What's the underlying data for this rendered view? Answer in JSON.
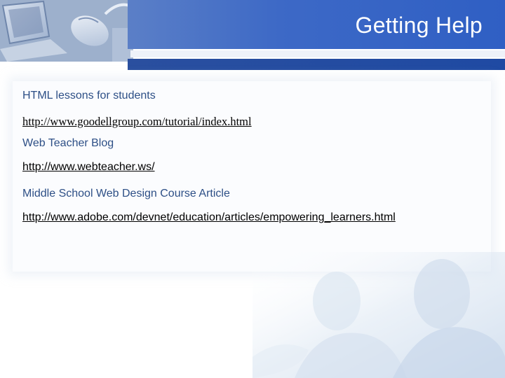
{
  "slide": {
    "title": "Getting Help",
    "items": [
      {
        "heading": "HTML lessons for students",
        "link": "http://www.goodellgroup.com/tutorial/index.html"
      },
      {
        "heading": "Web Teacher Blog",
        "link": "http://www.webteacher.ws/"
      },
      {
        "heading": "Middle School Web Design Course Article",
        "link": "http://www.adobe.com/devnet/education/articles/empowering_learners.html"
      }
    ]
  },
  "colors": {
    "banner": "#3d69c6",
    "heading_text": "#2d4f86",
    "link_text": "#000000"
  },
  "icons": {
    "header_image": "computer-mouse-photo",
    "watermark": "faded-people-photo"
  }
}
